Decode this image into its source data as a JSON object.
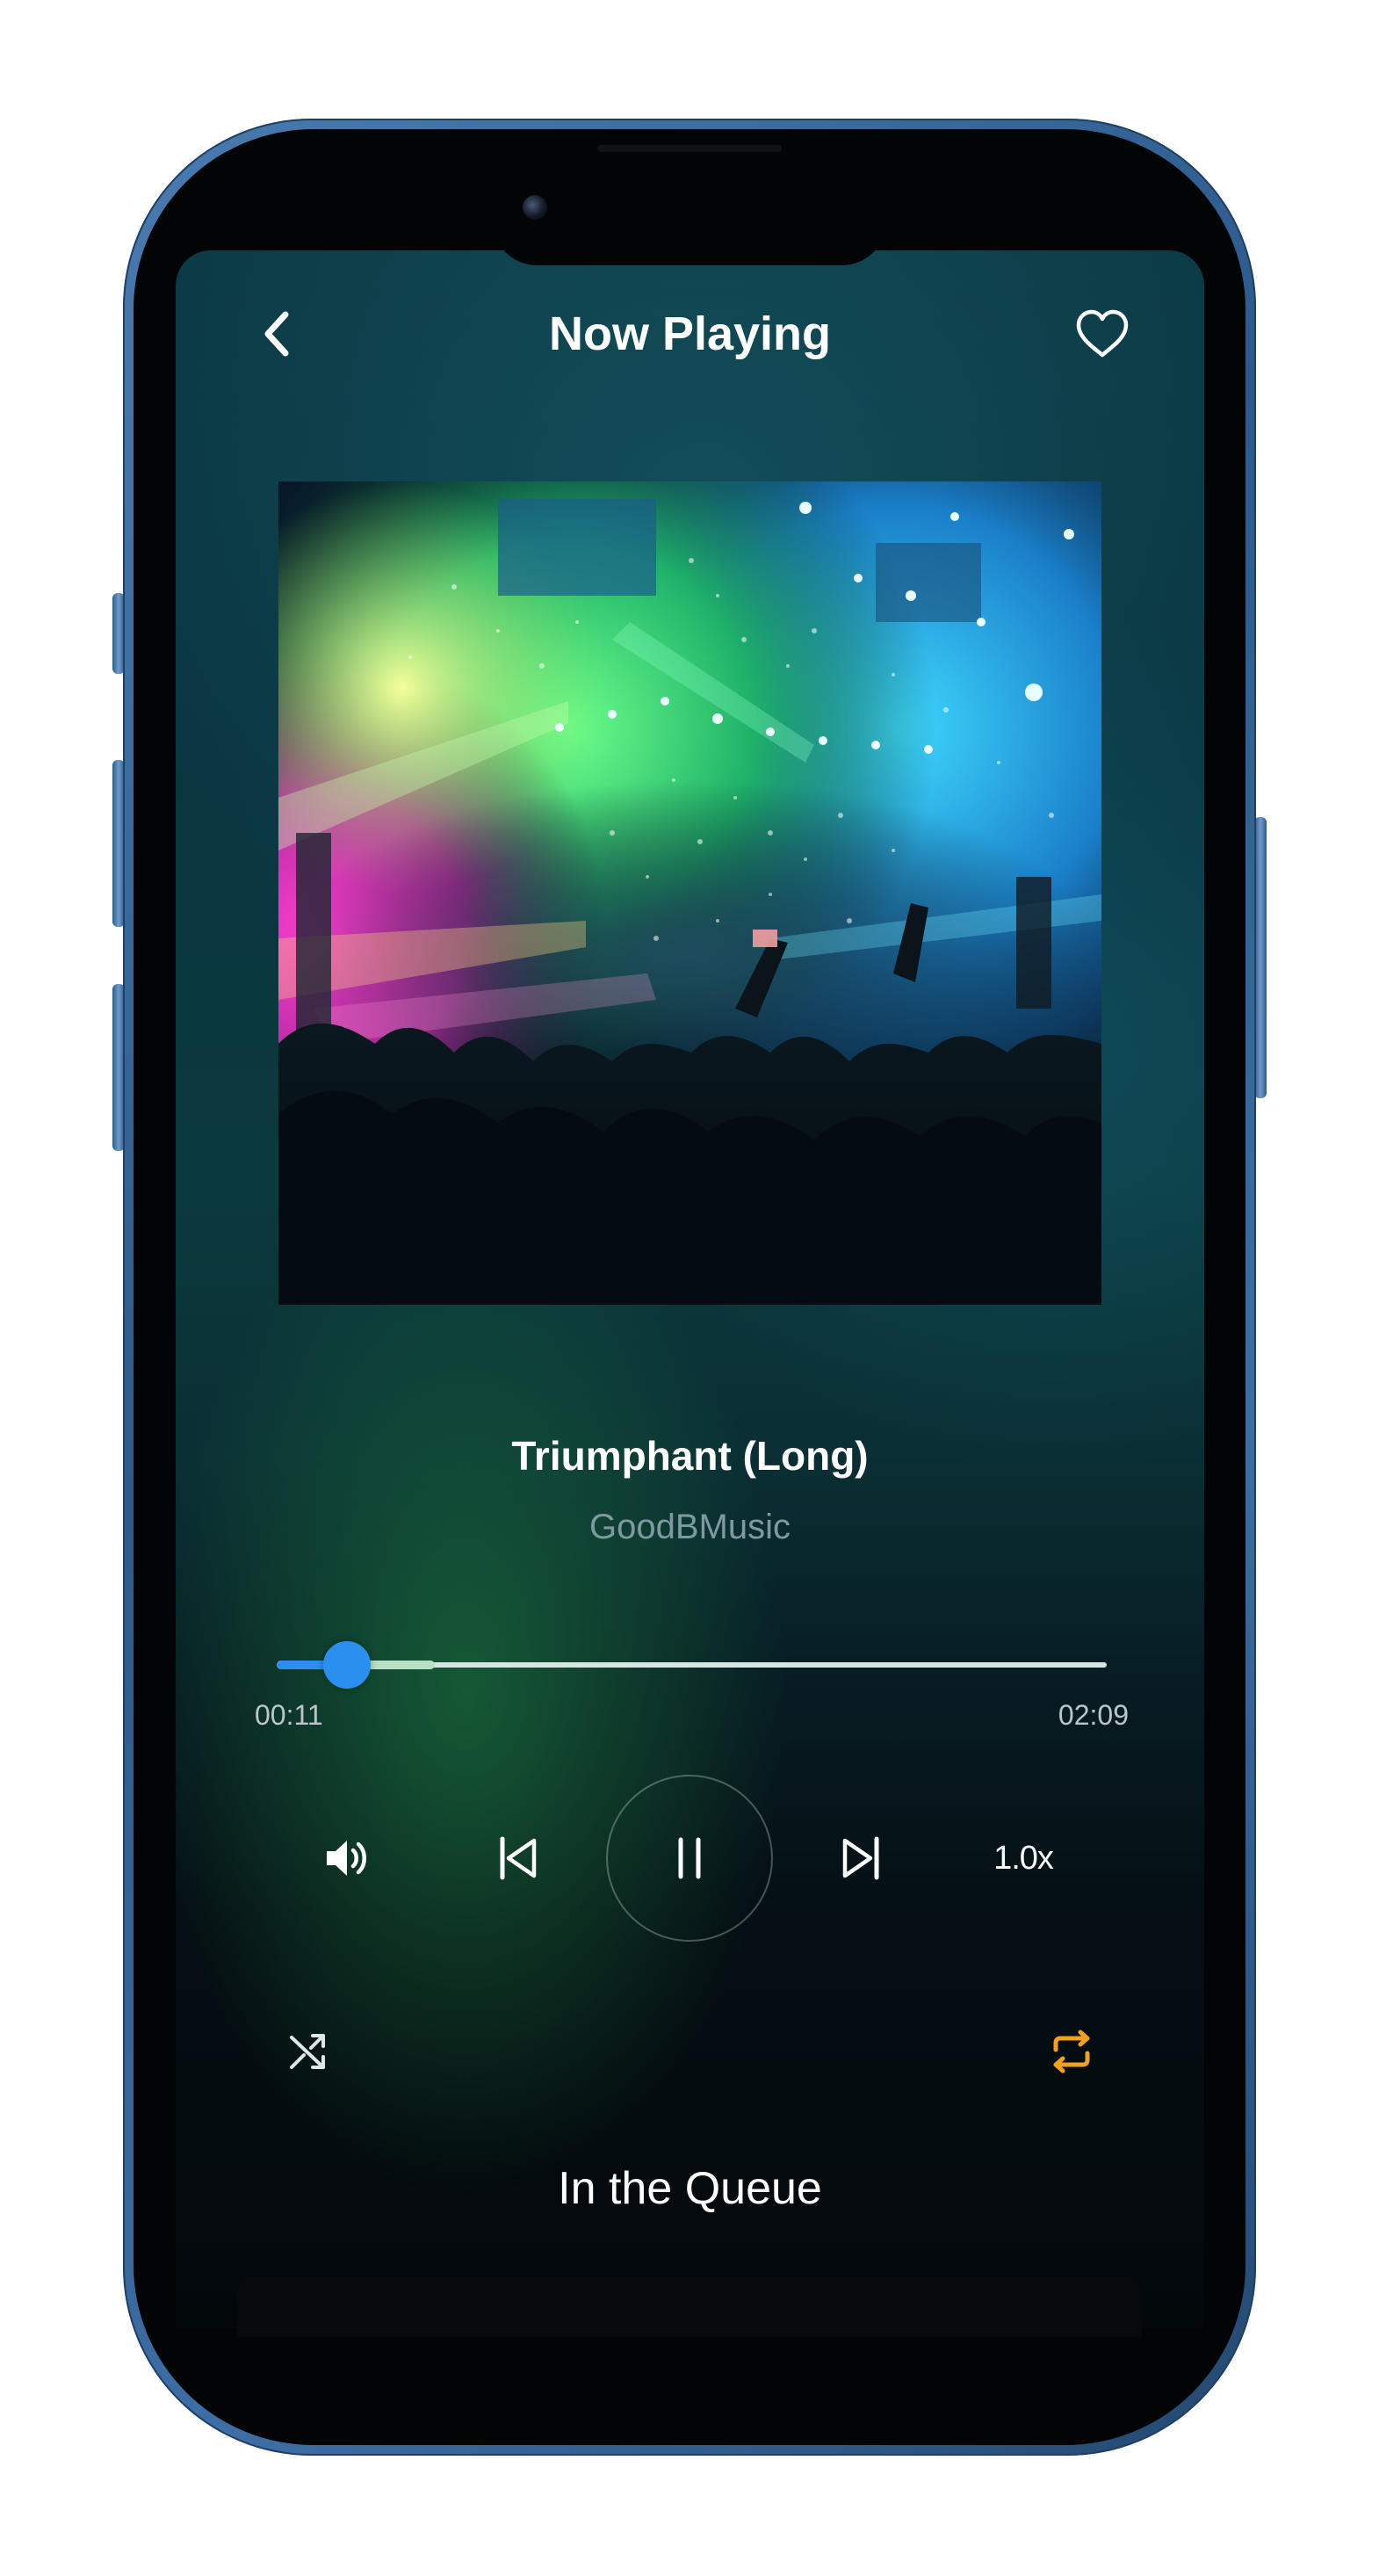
{
  "header": {
    "title": "Now Playing",
    "back_icon": "chevron-left-icon",
    "favorite_icon": "heart-outline-icon"
  },
  "track": {
    "title": "Triumphant (Long)",
    "artist": "GoodBMusic",
    "artwork": "concert-crowd-with-confetti-and-stage-lights"
  },
  "progress": {
    "elapsed": "00:11",
    "total": "02:09",
    "played_fraction": 0.085,
    "buffered_fraction": 0.19
  },
  "controls": {
    "volume_icon": "volume-icon",
    "previous_icon": "skip-previous-icon",
    "play_pause_icon": "pause-icon",
    "next_icon": "skip-next-icon",
    "speed": "1.0x",
    "shuffle_icon": "shuffle-icon",
    "repeat_icon": "repeat-icon",
    "repeat_active": true
  },
  "queue": {
    "title": "In the Queue"
  },
  "colors": {
    "accent": "#2b8ff0",
    "repeat_active": "#f0a21f",
    "artist_text": "#7e9aa0",
    "phone_frame": "#3d6ea5"
  }
}
